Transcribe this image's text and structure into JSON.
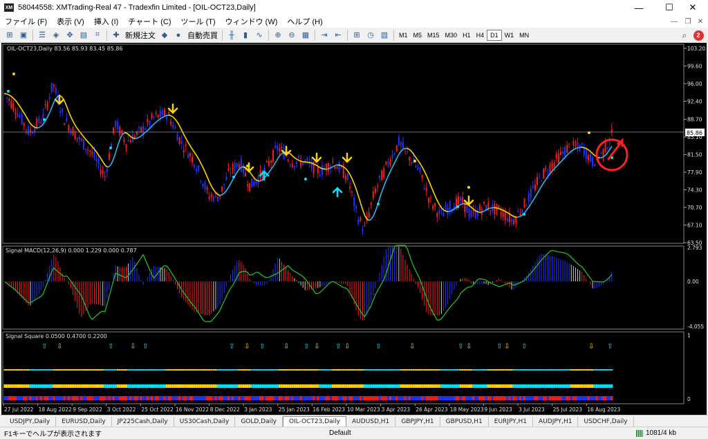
{
  "window": {
    "title": "58044558: XMTrading-Real 47 - Tradexfin Limited - [OIL-OCT23,Daily]",
    "logo": "XM",
    "min_glyph": "—",
    "max_glyph": "☐",
    "close_glyph": "✕"
  },
  "menu": [
    "ファイル (F)",
    "表示 (V)",
    "挿入 (I)",
    "チャート (C)",
    "ツール (T)",
    "ウィンドウ (W)",
    "ヘルプ (H)"
  ],
  "toolbar": {
    "new_order": "新規注文",
    "auto_trade": "自動売買",
    "timeframes": [
      "M1",
      "M5",
      "M15",
      "M30",
      "H1",
      "H4",
      "D1",
      "W1",
      "MN"
    ],
    "active_timeframe": "D1",
    "notifications": "2"
  },
  "chart": {
    "main_label": "OIL-OCT23,Daily  83.56 85.93 83.45 85.86",
    "current_price": "85.86",
    "price_ticks": [
      "103.20",
      "99.60",
      "96.00",
      "92.40",
      "88.70",
      "85.10",
      "81.50",
      "77.90",
      "74.30",
      "70.70",
      "67.10",
      "63.50"
    ],
    "macd_label": "Signal MACD(12,26,9) 0.000 1.229 0.000 0.787",
    "macd_ticks": [
      "2.793",
      "0.00",
      "-4.055"
    ],
    "square_label": "Signal Square 0.0500 0.4700 0.2200",
    "square_ticks": [
      "1",
      "0"
    ],
    "date_labels": [
      "27 Jul 2022",
      "18 Aug 2022",
      "9 Sep 2022",
      "3 Oct 2022",
      "25 Oct 2022",
      "16 Nov 2022",
      "8 Dec 2022",
      "3 Jan 2023",
      "25 Jan 2023",
      "16 Feb 2023",
      "10 Mar 2023",
      "3 Apr 2023",
      "26 Apr 2023",
      "18 May 2023",
      "9 Jun 2023",
      "3 Jul 2023",
      "25 Jul 2023",
      "16 Aug 2023"
    ],
    "colors": {
      "bull": "#2233ff",
      "bear": "#ff1a1a",
      "ma_up": "#29b6f6",
      "ma_down": "#ffd400",
      "arrow_down": "#ffd400",
      "arrow_up": "#00e5ff",
      "signal_line": "#22cc22",
      "annotation": "#ff2020"
    }
  },
  "tabs": [
    "USDJPY,Daily",
    "EURUSD,Daily",
    "JP225Cash,Daily",
    "US30Cash,Daily",
    "GOLD,Daily",
    "OIL-OCT23,Daily",
    "AUDUSD,H1",
    "GBPJPY,H1",
    "GBPUSD,H1",
    "EURJPY,H1",
    "AUDJPY,H1",
    "USDCHF,Daily"
  ],
  "active_tab": "OIL-OCT23,Daily",
  "status": {
    "help": "F1キーでヘルプが表示されます",
    "profile": "Default",
    "traffic": "1081/4 kb"
  }
}
